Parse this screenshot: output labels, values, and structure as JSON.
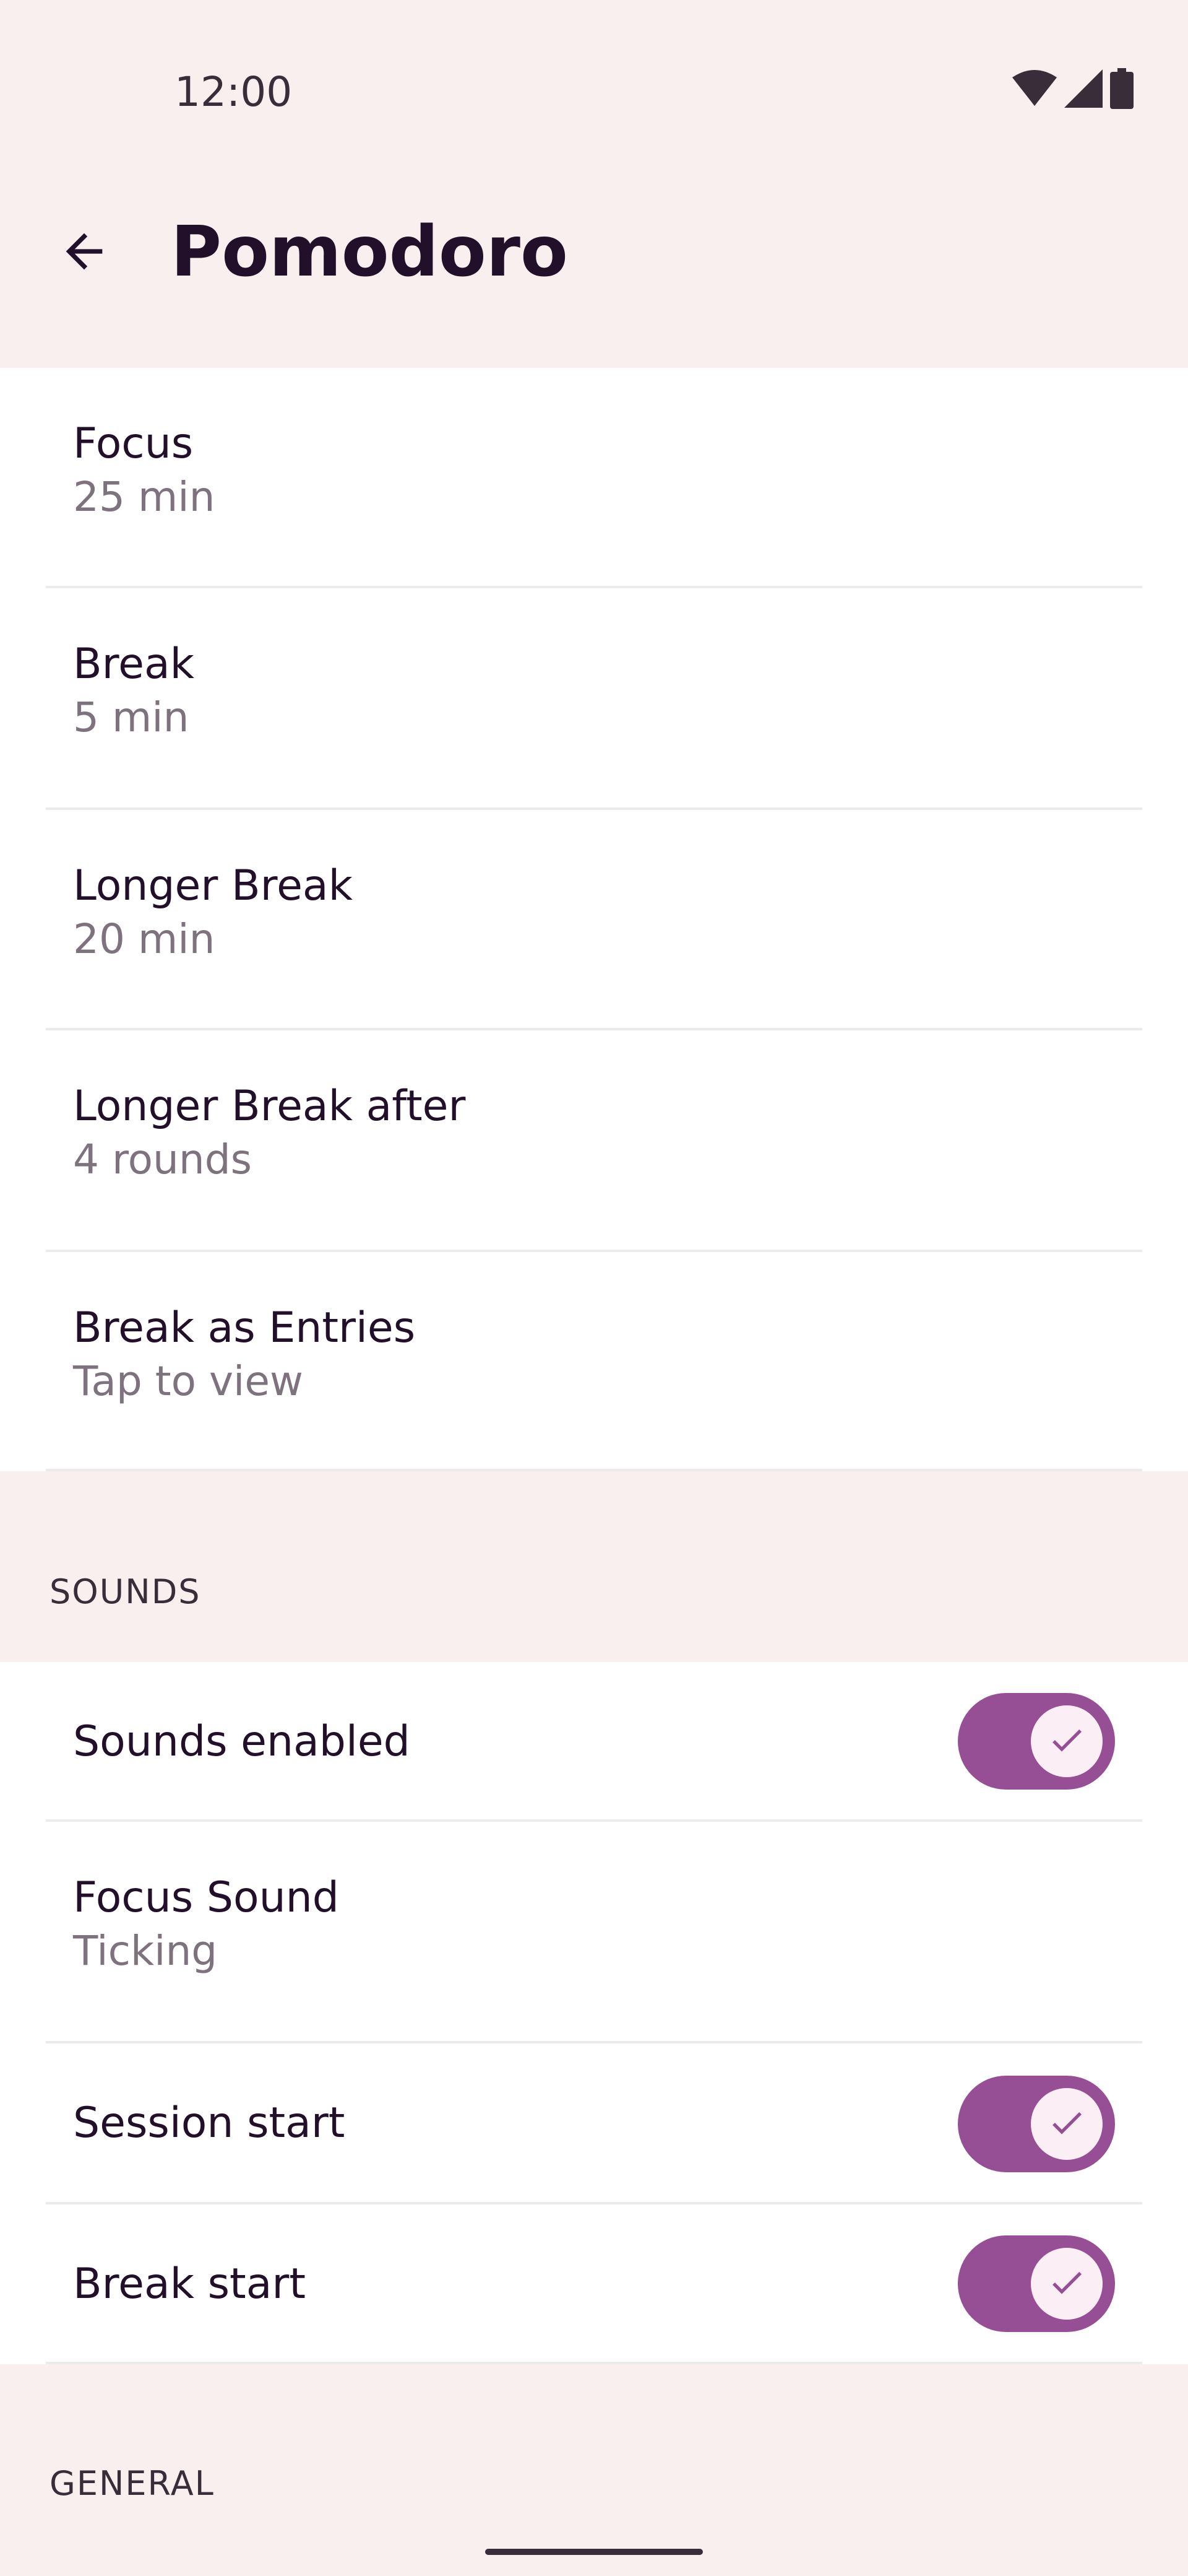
{
  "status_bar": {
    "time": "12:00",
    "icons": [
      "wifi-icon",
      "cellular-signal-icon",
      "battery-icon"
    ]
  },
  "app_bar": {
    "back_icon": "arrow-back-icon",
    "title": "Pomodoro"
  },
  "timer_settings": [
    {
      "title": "Focus",
      "value": "25 min"
    },
    {
      "title": "Break",
      "value": "5 min"
    },
    {
      "title": "Longer Break",
      "value": "20 min"
    },
    {
      "title": "Longer Break after",
      "value": "4 rounds"
    },
    {
      "title": "Break as Entries",
      "value": "Tap to view"
    }
  ],
  "sounds": {
    "header": "SOUNDS",
    "sounds_enabled": {
      "title": "Sounds enabled",
      "on": true
    },
    "focus_sound": {
      "title": "Focus Sound",
      "value": "Ticking"
    },
    "session_start": {
      "title": "Session start",
      "on": true
    },
    "break_start": {
      "title": "Break start",
      "on": true
    }
  },
  "general": {
    "header": "GENERAL"
  },
  "colors": {
    "background": "#f9efee",
    "surface": "#ffffff",
    "accent": "#964f94",
    "switch_thumb": "#fbeef5",
    "text_primary": "#22102b",
    "text_secondary": "#7e727e"
  }
}
